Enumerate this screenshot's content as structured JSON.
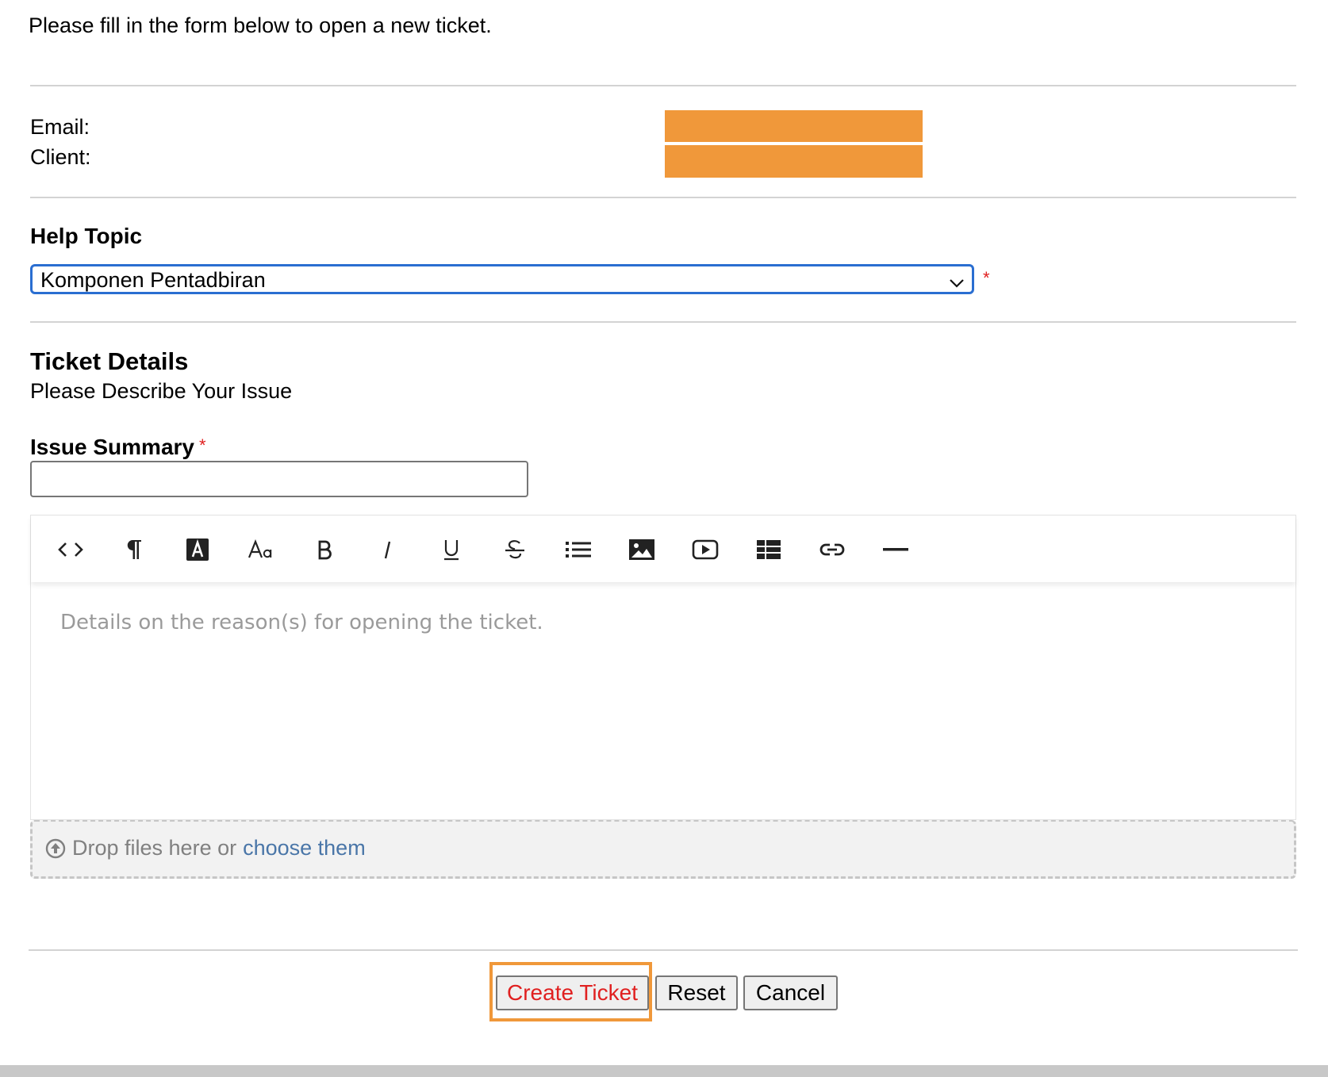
{
  "intro_text": "Please fill in the form below to open a new ticket.",
  "contact": {
    "email_label": "Email:",
    "client_label": "Client:"
  },
  "help_topic": {
    "title": "Help Topic",
    "selected": "Komponen Pentadbiran",
    "required_mark": "*"
  },
  "ticket_details": {
    "title": "Ticket Details",
    "subtitle": "Please Describe Your Issue"
  },
  "issue_summary": {
    "label": "Issue Summary",
    "required_mark": "*",
    "value": ""
  },
  "editor": {
    "toolbar": [
      {
        "name": "html-code-icon",
        "glyph": "<>"
      },
      {
        "name": "paragraph-icon",
        "glyph": "¶"
      },
      {
        "name": "text-color-icon",
        "glyph": "A"
      },
      {
        "name": "font-size-icon",
        "glyph": "Aa"
      },
      {
        "name": "bold-icon",
        "glyph": "B"
      },
      {
        "name": "italic-icon",
        "glyph": "I"
      },
      {
        "name": "underline-icon",
        "glyph": "U"
      },
      {
        "name": "strikethrough-icon",
        "glyph": "S"
      },
      {
        "name": "bullet-list-icon",
        "glyph": ""
      },
      {
        "name": "image-icon",
        "glyph": ""
      },
      {
        "name": "video-icon",
        "glyph": ""
      },
      {
        "name": "table-icon",
        "glyph": ""
      },
      {
        "name": "link-icon",
        "glyph": ""
      },
      {
        "name": "horizontal-rule-icon",
        "glyph": ""
      }
    ],
    "placeholder": "Details on the reason(s) for opening the ticket."
  },
  "dropzone": {
    "text": "Drop files here or",
    "link": "choose them"
  },
  "buttons": {
    "create": "Create Ticket",
    "reset": "Reset",
    "cancel": "Cancel"
  },
  "colors": {
    "redaction": "#f0983a",
    "focus_border": "#2a6ed1",
    "required": "#e02020",
    "link": "#4a76a8"
  }
}
